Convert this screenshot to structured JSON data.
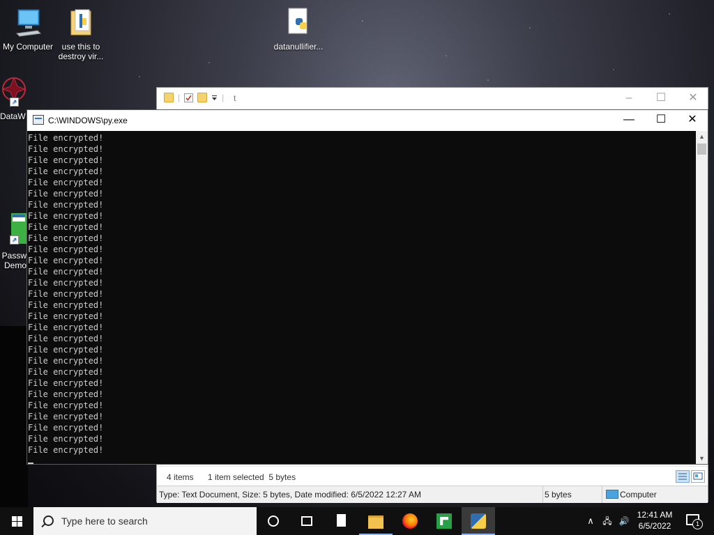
{
  "desktop": {
    "icons": [
      {
        "label": "My Computer"
      },
      {
        "label": "use this to destroy vir..."
      },
      {
        "label": "datanullifier..."
      },
      {
        "label": "DataW"
      },
      {
        "label": "Passw Demo"
      }
    ]
  },
  "explorer": {
    "title": "t",
    "status_items": "4 items",
    "status_selected": "1 item selected  5 bytes",
    "details_text": "Type: Text Document, Size: 5 bytes, Date modified: 6/5/2022 12:27 AM",
    "details_size": "5 bytes",
    "details_location": "Computer",
    "minimize": "–",
    "maximize": "☐",
    "close": "✕"
  },
  "console": {
    "title": "C:\\WINDOWS\\py.exe",
    "minimize": "—",
    "maximize": "☐",
    "close": "✕",
    "line_text": "File encrypted!",
    "line_count": 29
  },
  "taskbar": {
    "search_placeholder": "Type here to search",
    "time": "12:41 AM",
    "date": "6/5/2022",
    "notification_count": "1",
    "tray_chevron": "∧",
    "tray_network": "🖧",
    "tray_volume": "🔊"
  }
}
